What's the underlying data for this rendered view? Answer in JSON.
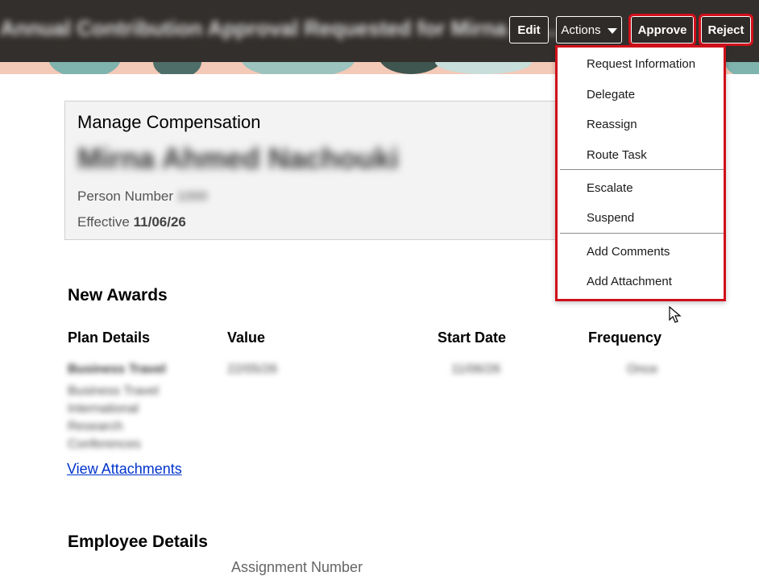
{
  "header": {
    "title": "Annual Contribution Approval Requested for Mirna Ah...",
    "edit_label": "Edit",
    "actions_label": "Actions",
    "approve_label": "Approve",
    "reject_label": "Reject"
  },
  "card": {
    "heading": "Manage Compensation",
    "person_name": "Mirna Ahmed Nachouki",
    "person_number_label": "Person Number",
    "person_number_value": "1000",
    "effective_label": "Effective",
    "effective_value": "11/06/26"
  },
  "new_awards": {
    "title": "New Awards",
    "columns": [
      "Plan Details",
      "Value",
      "Start Date",
      "Frequency"
    ],
    "row": {
      "plan_name": "Business Travel",
      "plan_lines": [
        "Business Travel",
        "International",
        "Research",
        "Conferences"
      ],
      "value": "22/05/26",
      "start_date": "11/06/26",
      "frequency": "Once"
    },
    "view_attachments": "View Attachments"
  },
  "employee_details": {
    "title": "Employee Details",
    "assignment_number_label": "Assignment Number"
  },
  "actions_menu": {
    "items": [
      "Request Information",
      "Delegate",
      "Reassign",
      "Route Task",
      "Escalate",
      "Suspend",
      "Add Comments",
      "Add Attachment"
    ]
  },
  "colors": {
    "topbar": "#332f2c",
    "highlight": "#d0101a",
    "link": "#0033cc"
  }
}
